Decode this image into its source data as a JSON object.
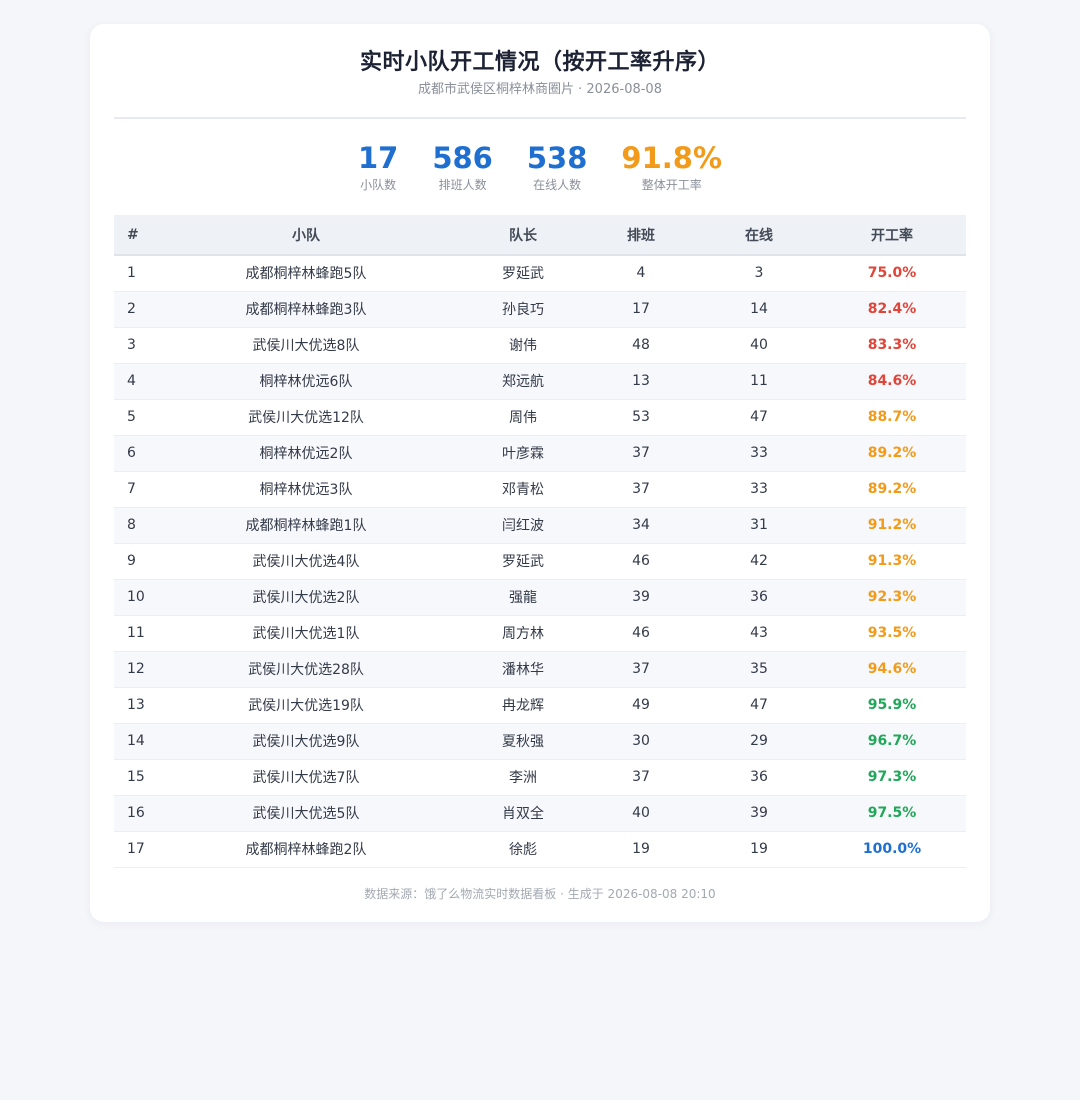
{
  "header": {
    "title": "实时小队开工情况（按开工率升序）",
    "subtitle": "成都市武侯区桐梓林商圈片 · 2026-08-08"
  },
  "stats": [
    {
      "value": "17",
      "label": "小队数",
      "color": "#1f6fd1"
    },
    {
      "value": "586",
      "label": "排班人数",
      "color": "#1f6fd1"
    },
    {
      "value": "538",
      "label": "在线人数",
      "color": "#1f6fd1"
    },
    {
      "value": "91.8%",
      "label": "整体开工率",
      "color": "#f29a1a"
    }
  ],
  "table": {
    "columns": [
      "#",
      "小队",
      "队长",
      "排班",
      "在线",
      "开工率"
    ],
    "rows": [
      {
        "no": "1",
        "team": "成都桐梓林蜂跑5队",
        "leader": "罗延武",
        "scheduled": "4",
        "online": "3",
        "rate": "75.0%",
        "level": "red"
      },
      {
        "no": "2",
        "team": "成都桐梓林蜂跑3队",
        "leader": "孙良巧",
        "scheduled": "17",
        "online": "14",
        "rate": "82.4%",
        "level": "red"
      },
      {
        "no": "3",
        "team": "武侯川大优选8队",
        "leader": "谢伟",
        "scheduled": "48",
        "online": "40",
        "rate": "83.3%",
        "level": "red"
      },
      {
        "no": "4",
        "team": "桐梓林优远6队",
        "leader": "郑远航",
        "scheduled": "13",
        "online": "11",
        "rate": "84.6%",
        "level": "red"
      },
      {
        "no": "5",
        "team": "武侯川大优选12队",
        "leader": "周伟",
        "scheduled": "53",
        "online": "47",
        "rate": "88.7%",
        "level": "orange"
      },
      {
        "no": "6",
        "team": "桐梓林优远2队",
        "leader": "叶彦霖",
        "scheduled": "37",
        "online": "33",
        "rate": "89.2%",
        "level": "orange"
      },
      {
        "no": "7",
        "team": "桐梓林优远3队",
        "leader": "邓青松",
        "scheduled": "37",
        "online": "33",
        "rate": "89.2%",
        "level": "orange"
      },
      {
        "no": "8",
        "team": "成都桐梓林蜂跑1队",
        "leader": "闫红波",
        "scheduled": "34",
        "online": "31",
        "rate": "91.2%",
        "level": "orange"
      },
      {
        "no": "9",
        "team": "武侯川大优选4队",
        "leader": "罗延武",
        "scheduled": "46",
        "online": "42",
        "rate": "91.3%",
        "level": "orange"
      },
      {
        "no": "10",
        "team": "武侯川大优选2队",
        "leader": "强龍",
        "scheduled": "39",
        "online": "36",
        "rate": "92.3%",
        "level": "orange"
      },
      {
        "no": "11",
        "team": "武侯川大优选1队",
        "leader": "周方林",
        "scheduled": "46",
        "online": "43",
        "rate": "93.5%",
        "level": "orange"
      },
      {
        "no": "12",
        "team": "武侯川大优选28队",
        "leader": "潘林华",
        "scheduled": "37",
        "online": "35",
        "rate": "94.6%",
        "level": "orange"
      },
      {
        "no": "13",
        "team": "武侯川大优选19队",
        "leader": "冉龙辉",
        "scheduled": "49",
        "online": "47",
        "rate": "95.9%",
        "level": "green"
      },
      {
        "no": "14",
        "team": "武侯川大优选9队",
        "leader": "夏秋强",
        "scheduled": "30",
        "online": "29",
        "rate": "96.7%",
        "level": "green"
      },
      {
        "no": "15",
        "team": "武侯川大优选7队",
        "leader": "李洲",
        "scheduled": "37",
        "online": "36",
        "rate": "97.3%",
        "level": "green"
      },
      {
        "no": "16",
        "team": "武侯川大优选5队",
        "leader": "肖双全",
        "scheduled": "40",
        "online": "39",
        "rate": "97.5%",
        "level": "green"
      },
      {
        "no": "17",
        "team": "成都桐梓林蜂跑2队",
        "leader": "徐彪",
        "scheduled": "19",
        "online": "19",
        "rate": "100.0%",
        "level": "blue"
      }
    ]
  },
  "footer": {
    "text": "数据来源：饿了么物流实时数据看板 · 生成于 2026-08-08 20:10"
  },
  "colors": {
    "red": "#e0453a",
    "orange": "#f29a1a",
    "green": "#21a75a",
    "blue": "#1f6fd1"
  }
}
